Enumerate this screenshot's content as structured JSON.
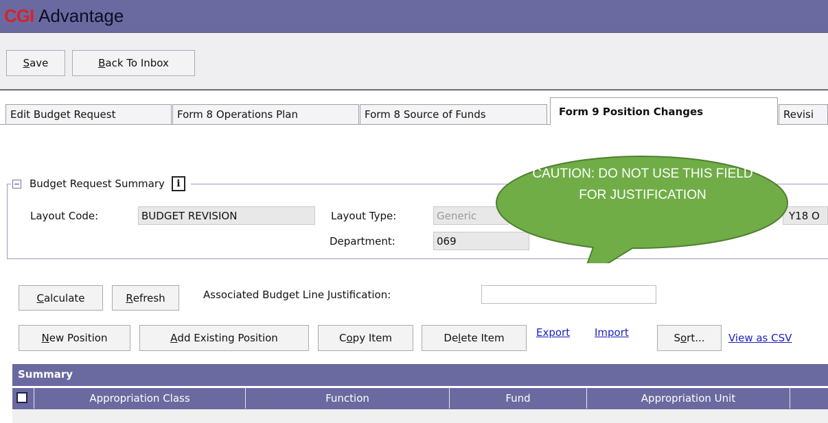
{
  "header": {
    "logo": "CGI",
    "title": "Advantage"
  },
  "toolbar": {
    "save": "ave",
    "save_key": "S",
    "back_key": "B",
    "back": "ack To Inbox"
  },
  "tabs": [
    {
      "label": "Edit Budget Request"
    },
    {
      "label": "Form 8 Operations Plan"
    },
    {
      "label": "Form 8 Source of Funds"
    },
    {
      "label": "Form 9 Position Changes",
      "active": true
    },
    {
      "label": "Revisi"
    }
  ],
  "summary": {
    "title": "Budget Request Summary",
    "info_icon": "i",
    "layout_code_label": "Layout Code:",
    "layout_code_value": "BUDGET REVISION",
    "layout_type_label": "Layout Type:",
    "layout_type_value": "Generic",
    "department_label": "Department:",
    "department_value": "069",
    "partial_value": "Y18 O"
  },
  "callout": {
    "text": "CAUTION: DO NOT USE THIS FIELD FOR JUSTIFICATION",
    "color": "#70ad47"
  },
  "actions": {
    "calculate_key": "C",
    "calculate": "alculate",
    "refresh_key": "R",
    "refresh": "efresh",
    "justification_label": "Associated Budget Line Justification:",
    "justification_value": ""
  },
  "grid_actions": {
    "new_key": "N",
    "new": "ew Position",
    "add_key": "A",
    "add": "dd Existing Position",
    "copy_pre": "C",
    "copy_key": "o",
    "copy_post": "py Item",
    "delete_pre": "De",
    "delete_key": "l",
    "delete_post": "ete Item",
    "export": "Export",
    "import": "Import",
    "sort_pre": "S",
    "sort_key": "o",
    "sort_post": "rt...",
    "csv": "View as CSV"
  },
  "grid": {
    "title": "Summary",
    "columns": [
      "Appropriation Class",
      "Function",
      "Fund",
      "Appropriation Unit"
    ]
  }
}
